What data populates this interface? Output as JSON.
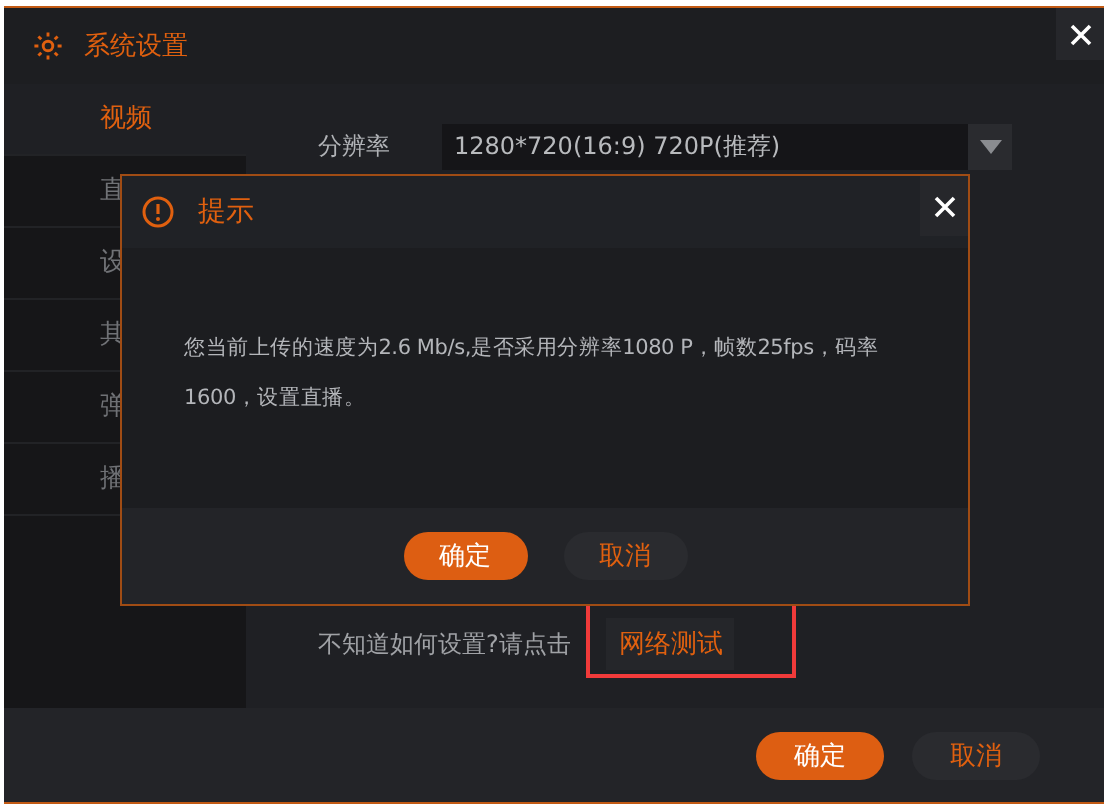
{
  "window": {
    "title": "系统设置"
  },
  "sidebar": {
    "items": [
      {
        "label": "视频",
        "selected": true
      },
      {
        "label": "直",
        "selected": false
      },
      {
        "label": "设",
        "selected": false
      },
      {
        "label": "其",
        "selected": false
      },
      {
        "label": "弹",
        "selected": false
      },
      {
        "label": "播",
        "selected": false
      }
    ]
  },
  "resolution": {
    "label": "分辨率",
    "value": "1280*720(16:9) 720P(推荐)"
  },
  "help": {
    "text": "不知道如何设置?请点击",
    "button": "网络测试",
    "highlighted": true
  },
  "buttons": [
    "确定",
    "取消"
  ],
  "dialog": {
    "title": "提示",
    "message": "您当前上传的速度为2.6 Mb/s,是否采用分辨率1080 P，帧数25fps，码率1600，设置直播。",
    "buttons": [
      "确定",
      "取消"
    ]
  }
}
